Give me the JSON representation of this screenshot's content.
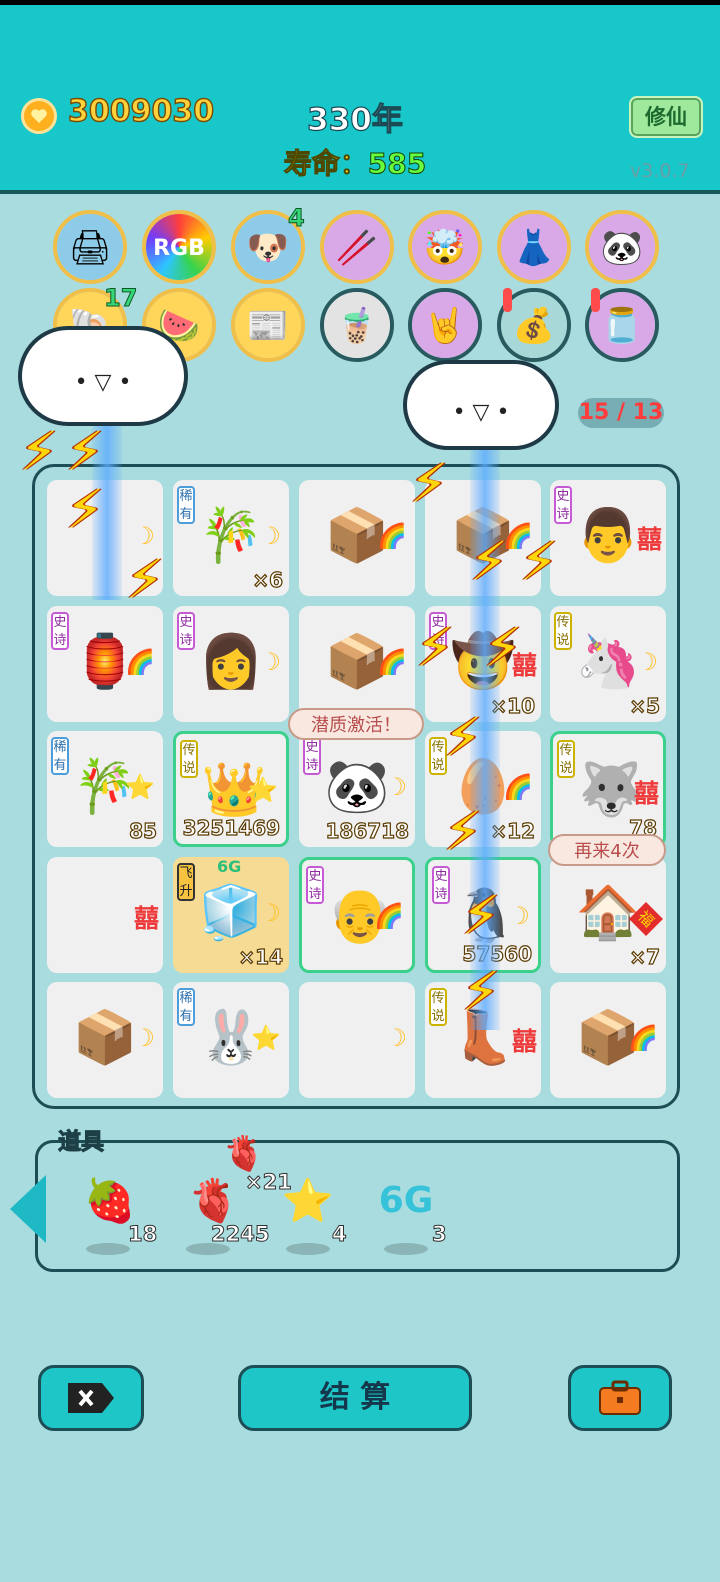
{
  "header": {
    "gold": "3009030",
    "year": "330年",
    "lifespan_label": "寿命：",
    "lifespan_value": "585",
    "cultivate_label": "修仙",
    "version": "v3.0.7",
    "icon_badge_1": "4",
    "icon_badge_2": "17"
  },
  "board": {
    "counter": "15 / 13",
    "tags": {
      "rare": "稀有",
      "epic": "史诗",
      "legend": "传说",
      "fly": "飞升"
    },
    "xi_symbol": "囍",
    "generation_tag": "6G",
    "cells": [
      {
        "count": ""
      },
      {
        "count": "×6"
      },
      {
        "count": ""
      },
      {
        "count": ""
      },
      {
        "count": ""
      },
      {
        "count": ""
      },
      {
        "count": ""
      },
      {
        "count": ""
      },
      {
        "count": "×10"
      },
      {
        "count": "×5"
      },
      {
        "count": "85"
      },
      {
        "count": "3251469"
      },
      {
        "count": "186718"
      },
      {
        "count": "×12"
      },
      {
        "count": "78"
      },
      {
        "count": ""
      },
      {
        "count": "×14"
      },
      {
        "count": ""
      },
      {
        "count": "57560"
      },
      {
        "count": "×7"
      },
      {
        "count": ""
      },
      {
        "count": ""
      },
      {
        "count": ""
      },
      {
        "count": ""
      },
      {
        "count": ""
      }
    ],
    "bubble_activate": "潜质激活！",
    "bubble_again": "再来4次",
    "fortune_char": "福"
  },
  "props": {
    "title": "道具",
    "items": [
      {
        "name": "lychee",
        "count": "18"
      },
      {
        "name": "liver",
        "count": "2245",
        "extra": "×21"
      },
      {
        "name": "star",
        "count": "4"
      },
      {
        "name": "6G",
        "count": "3"
      }
    ]
  },
  "footer": {
    "settle_label": "结 算"
  },
  "colors": {
    "topbar": "#18c7c9",
    "background": "#a9dcdf",
    "gold_text": "#ffd23d",
    "lifespan_value": "#67ff3f",
    "button": "#1ec6c7"
  }
}
